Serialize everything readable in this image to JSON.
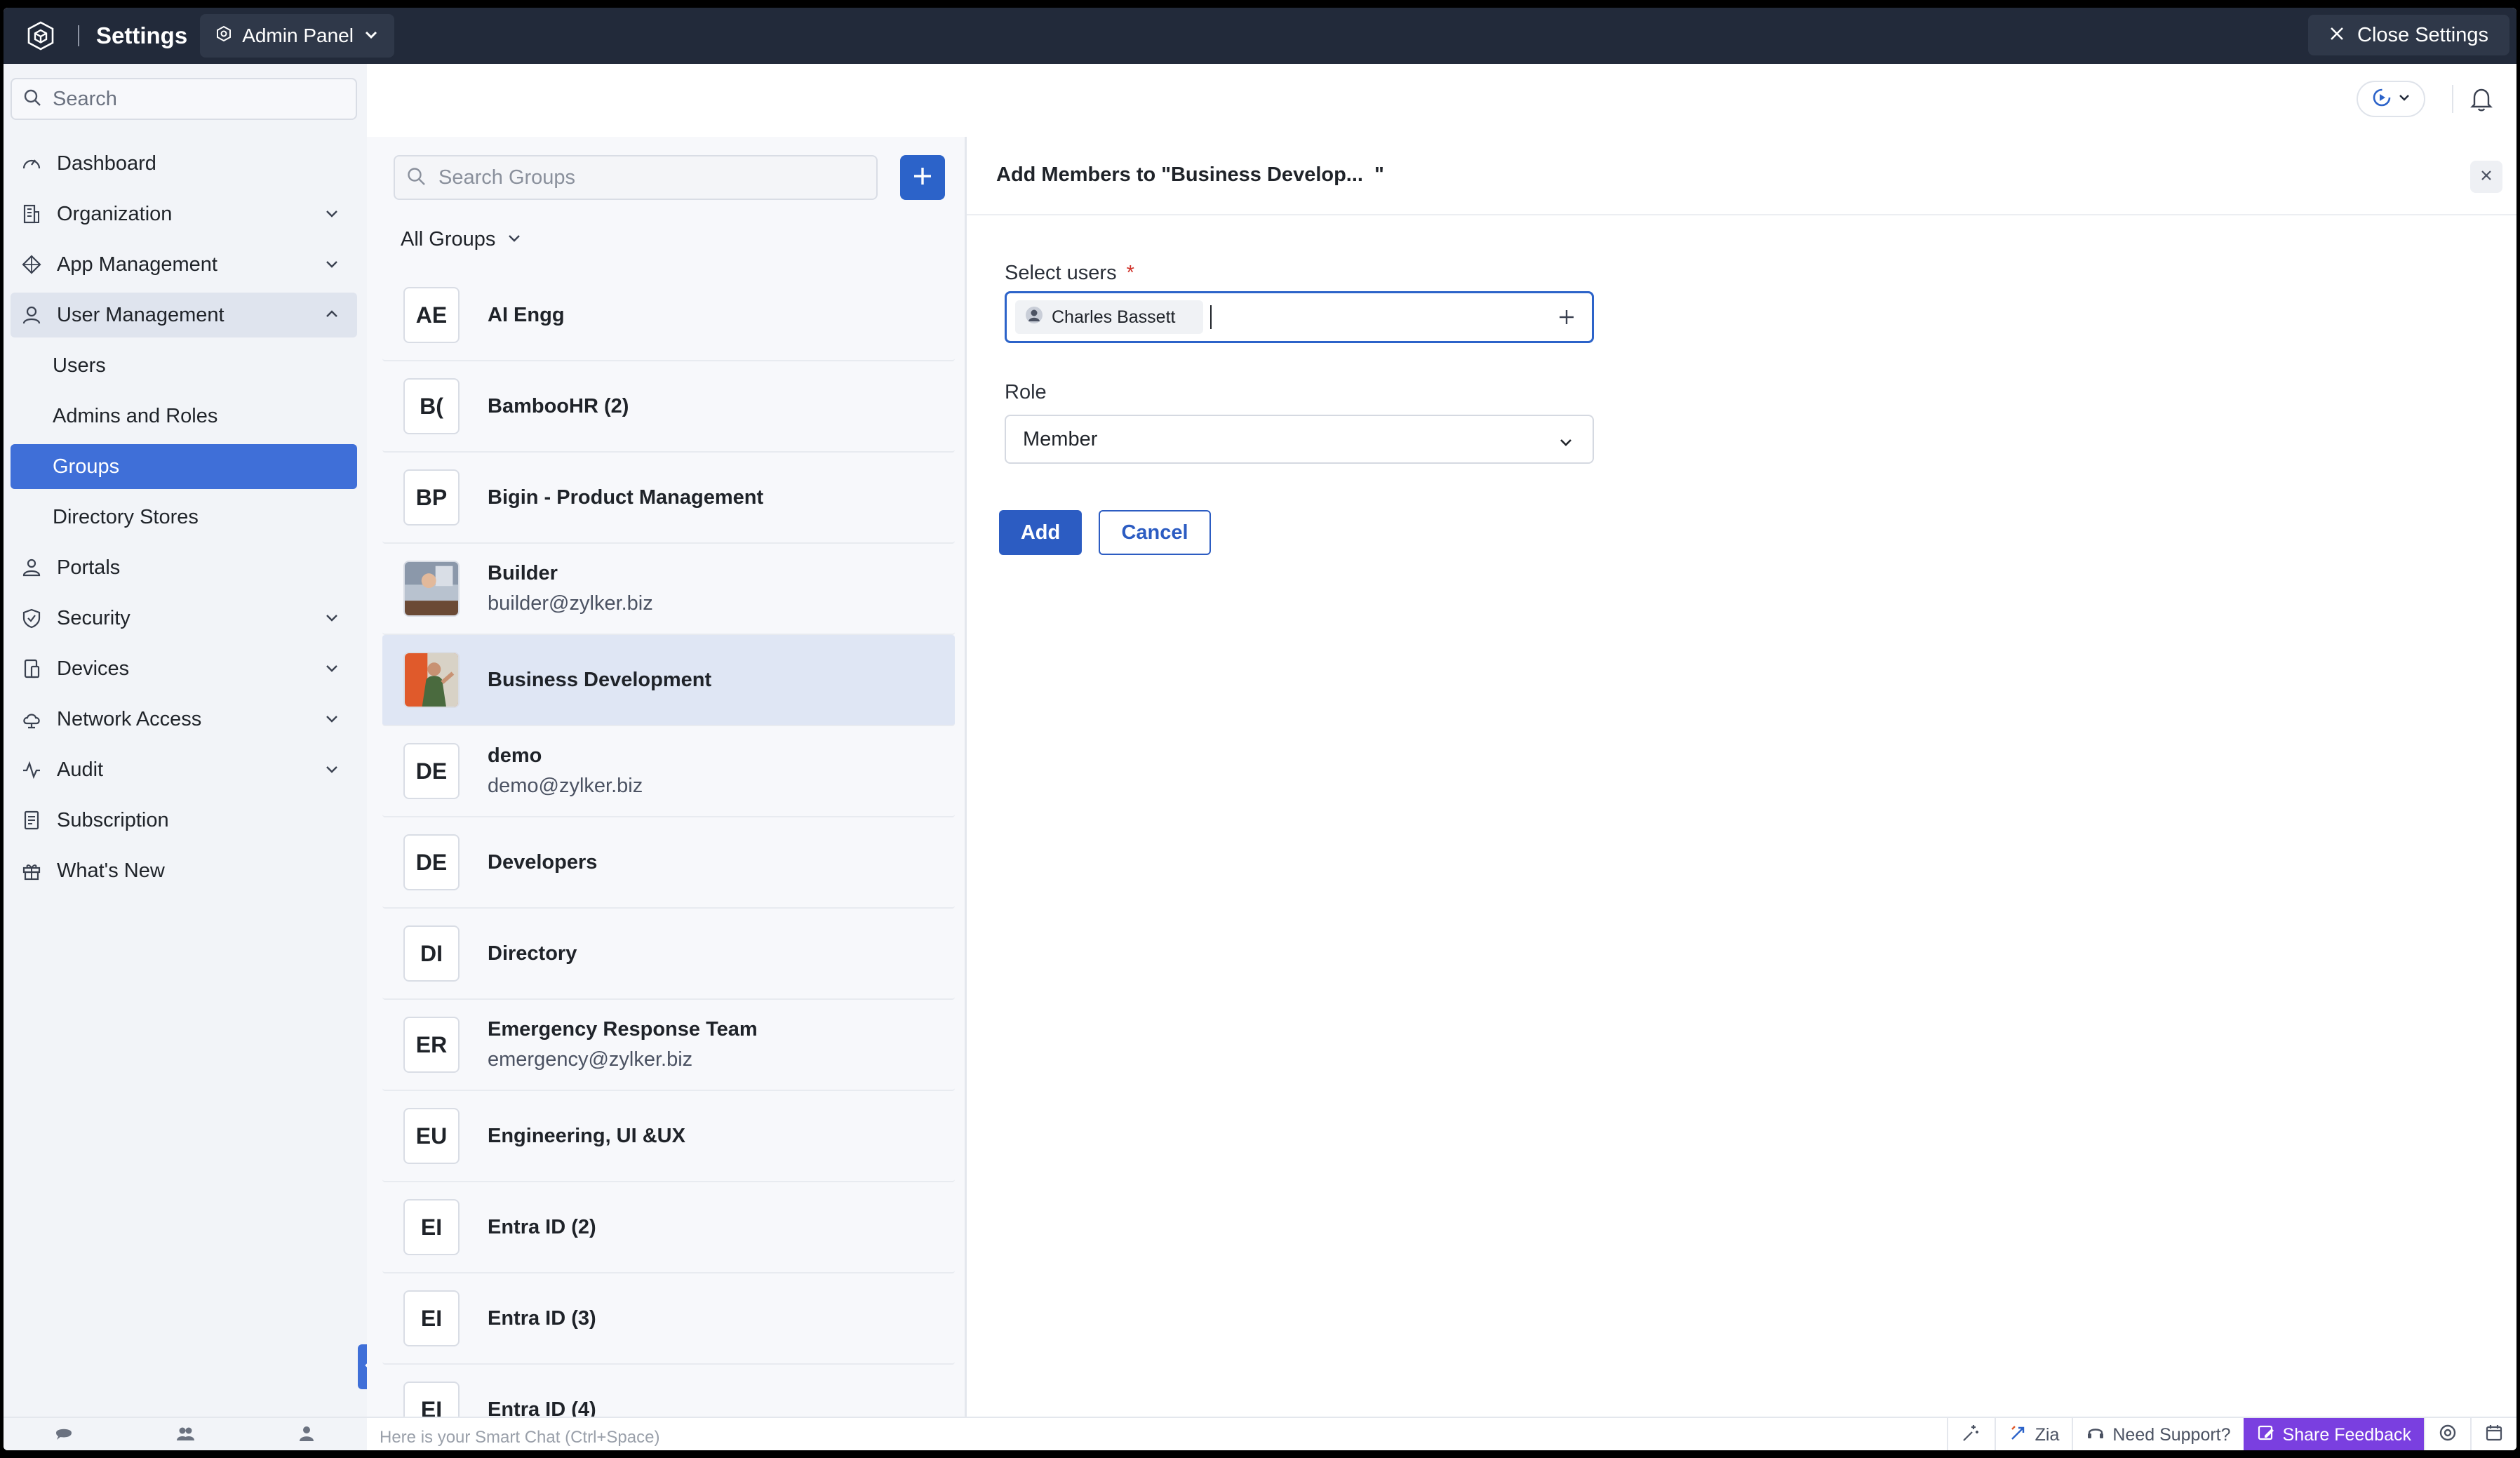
{
  "topbar": {
    "title": "Settings",
    "panel_label": "Admin Panel",
    "close_label": "Close Settings"
  },
  "sidebar": {
    "search_placeholder": "Search",
    "items": [
      {
        "label": "Dashboard",
        "icon": "gauge-icon"
      },
      {
        "label": "Organization",
        "icon": "building-icon"
      },
      {
        "label": "App Management",
        "icon": "apps-icon"
      },
      {
        "label": "User Management",
        "icon": "user-icon"
      },
      {
        "label": "Users"
      },
      {
        "label": "Admins and Roles"
      },
      {
        "label": "Groups"
      },
      {
        "label": "Directory Stores"
      },
      {
        "label": "Portals",
        "icon": "portal-icon"
      },
      {
        "label": "Security",
        "icon": "shield-icon"
      },
      {
        "label": "Devices",
        "icon": "device-icon"
      },
      {
        "label": "Network Access",
        "icon": "cloud-icon"
      },
      {
        "label": "Audit",
        "icon": "activity-icon"
      },
      {
        "label": "Subscription",
        "icon": "receipt-icon"
      },
      {
        "label": "What's New",
        "icon": "gift-icon"
      }
    ]
  },
  "groups": {
    "search_placeholder": "Search Groups",
    "filter_label": "All Groups",
    "list": [
      {
        "initials": "AE",
        "name": "AI Engg",
        "email": ""
      },
      {
        "initials": "B(",
        "name": "BambooHR (2)",
        "email": ""
      },
      {
        "initials": "BP",
        "name": "Bigin - Product Management",
        "email": ""
      },
      {
        "initials": "",
        "name": "Builder",
        "email": "builder@zylker.biz"
      },
      {
        "initials": "",
        "name": "Business Development",
        "email": ""
      },
      {
        "initials": "DE",
        "name": "demo",
        "email": "demo@zylker.biz"
      },
      {
        "initials": "DE",
        "name": "Developers",
        "email": ""
      },
      {
        "initials": "DI",
        "name": "Directory",
        "email": ""
      },
      {
        "initials": "ER",
        "name": "Emergency Response Team",
        "email": "emergency@zylker.biz"
      },
      {
        "initials": "EU",
        "name": "Engineering, UI &UX",
        "email": ""
      },
      {
        "initials": "EI",
        "name": "Entra ID (2)",
        "email": ""
      },
      {
        "initials": "EI",
        "name": "Entra ID (3)",
        "email": ""
      },
      {
        "initials": "EI",
        "name": "Entra ID (4)",
        "email": ""
      }
    ]
  },
  "panel": {
    "title": "Add Members to \"Business Develop...  \"",
    "select_users_label": "Select users",
    "required_mark": "*",
    "selected_user": "Charles Bassett",
    "role_label": "Role",
    "role_value": "Member",
    "add_label": "Add",
    "cancel_label": "Cancel"
  },
  "bottombar": {
    "chat_placeholder": "Here is your Smart Chat (Ctrl+Space)",
    "zia_label": "Zia",
    "support_label": "Need Support?",
    "feedback_label": "Share Feedback"
  },
  "colors": {
    "topbar": "#222a3a",
    "accent": "#2c63c9",
    "sidebar_active": "#3f6fd8",
    "feedback": "#7a3fe0"
  }
}
